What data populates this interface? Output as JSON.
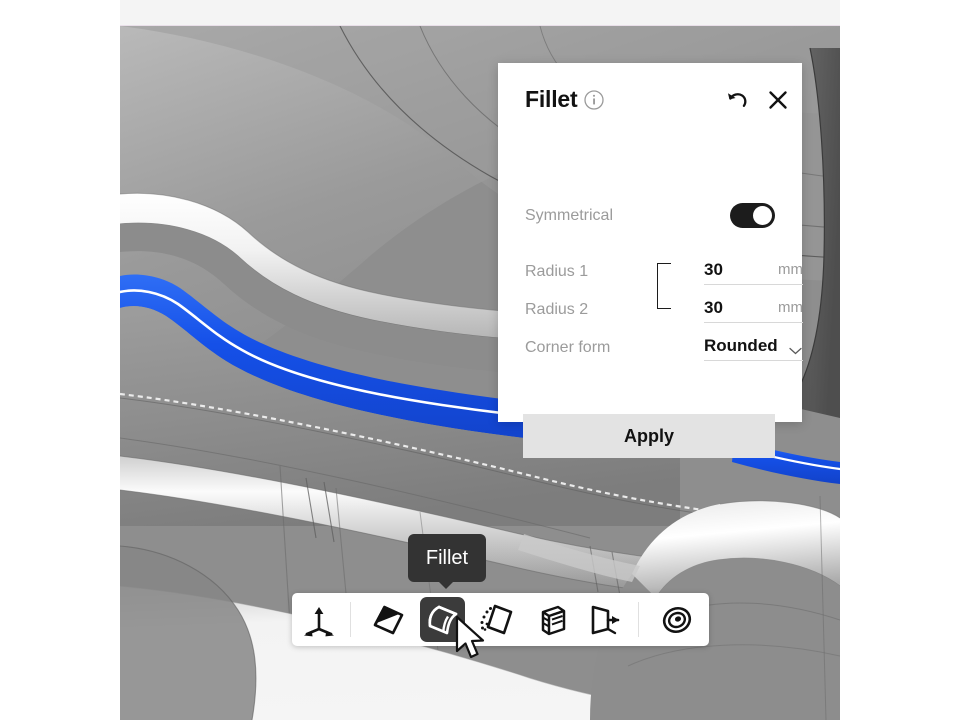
{
  "app": {
    "viewport_background": "#8e8e8e",
    "selection_color": "#1a5cf0",
    "accent_dark": "#1c1c1c"
  },
  "panel": {
    "title": "Fillet",
    "info_icon": "info-circle-icon",
    "undo_icon": "undo-icon",
    "close_icon": "close-icon",
    "fields": {
      "symmetrical": {
        "label": "Symmetrical",
        "toggle_state": "on"
      },
      "radius1": {
        "label": "Radius 1",
        "value": "30",
        "unit": "mm"
      },
      "radius2": {
        "label": "Radius 2",
        "value": "30",
        "unit": "mm"
      },
      "corner_form": {
        "label": "Corner form",
        "value": "Rounded",
        "caret_icon": "chevron-down-icon"
      }
    },
    "apply_label": "Apply"
  },
  "tooltip": {
    "label": "Fillet"
  },
  "toolbar": {
    "items": [
      {
        "name": "move-gizmo",
        "label": "Move",
        "icon": "three-axis-gizmo-icon",
        "active": false
      },
      {
        "name": "chamfer",
        "label": "Chamfer",
        "icon": "chamfer-edge-icon",
        "active": false
      },
      {
        "name": "fillet",
        "label": "Fillet",
        "icon": "fillet-edge-icon",
        "active": true
      },
      {
        "name": "draft",
        "label": "Draft",
        "icon": "draft-face-icon",
        "active": false
      },
      {
        "name": "rib",
        "label": "Rib",
        "icon": "ribbed-block-icon",
        "active": false
      },
      {
        "name": "mirror",
        "label": "Mirror",
        "icon": "mirror-flip-icon",
        "active": false
      },
      {
        "name": "shell",
        "label": "Shell",
        "icon": "shell-rings-icon",
        "active": false
      }
    ]
  },
  "cursor": {
    "icon": "mouse-pointer-icon"
  }
}
